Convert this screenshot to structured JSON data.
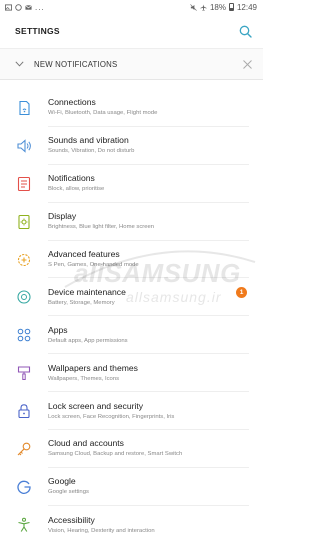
{
  "status_bar": {
    "battery": "18%",
    "time": "12:49",
    "overflow": "..."
  },
  "header": {
    "title": "SETTINGS"
  },
  "notification_banner": {
    "label": "NEW NOTIFICATIONS"
  },
  "items": [
    {
      "title": "Connections",
      "subtitle": "Wi-Fi, Bluetooth, Data usage, Flight mode",
      "icon": "connections-icon",
      "color": "#3d8fd8"
    },
    {
      "title": "Sounds and vibration",
      "subtitle": "Sounds, Vibration, Do not disturb",
      "icon": "speaker-icon",
      "color": "#4f8fd6"
    },
    {
      "title": "Notifications",
      "subtitle": "Block, allow, prioritise",
      "icon": "notifications-icon",
      "color": "#e3504a"
    },
    {
      "title": "Display",
      "subtitle": "Brightness, Blue light filter, Home screen",
      "icon": "display-icon",
      "color": "#8fb21e"
    },
    {
      "title": "Advanced features",
      "subtitle": "S Pen, Games, One-handed mode",
      "icon": "gear-plus-icon",
      "color": "#e8a326"
    },
    {
      "title": "Device maintenance",
      "subtitle": "Battery, Storage, Memory",
      "icon": "maintenance-icon",
      "color": "#36a8a2",
      "badge": "1"
    },
    {
      "title": "Apps",
      "subtitle": "Default apps, App permissions",
      "icon": "apps-icon",
      "color": "#3c7fd1"
    },
    {
      "title": "Wallpapers and themes",
      "subtitle": "Wallpapers, Themes, Icons",
      "icon": "paintbrush-icon",
      "color": "#9157b7"
    },
    {
      "title": "Lock screen and security",
      "subtitle": "Lock screen, Face Recognition, Fingerprints, Iris",
      "icon": "lock-icon",
      "color": "#4a63c8"
    },
    {
      "title": "Cloud and accounts",
      "subtitle": "Samsung Cloud, Backup and restore, Smart Switch",
      "icon": "key-icon",
      "color": "#e38a2c"
    },
    {
      "title": "Google",
      "subtitle": "Google settings",
      "icon": "google-icon",
      "color": "#4a7fd6"
    },
    {
      "title": "Accessibility",
      "subtitle": "Vision, Hearing, Dexterity and interaction",
      "icon": "accessibility-icon",
      "color": "#5aa63f"
    }
  ],
  "watermark": {
    "word": "allSAMSUNG",
    "url": "allsamsung.ir"
  },
  "colors": {
    "accent": "#3aa5c3",
    "badge": "#f07a1c"
  }
}
